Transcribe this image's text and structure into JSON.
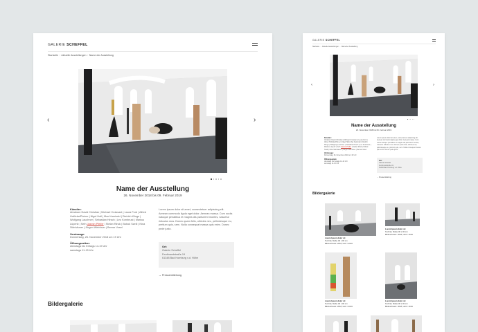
{
  "brand": {
    "name_light": "GALERIE ",
    "name_bold": "SCHEFFEL"
  },
  "breadcrumb": [
    "Startseite",
    "Aktuelle Ausstellungen",
    "Name der Ausstellung"
  ],
  "breadcrumb_separator": "›",
  "exhibition": {
    "title": "Name der Ausstellung",
    "dates": "26. November 2018 bis 09. Februar 2019",
    "artists_label": "Künstler:",
    "artists_before": "Abraham David Christian | Michael Croissant | Laura Ford | Alfred Hrdlicka/Ploiner | Nigel Hall | Max Kaminski | Dietrich Klinge | Wolfgang Lauchner | Sebastian Hirsch | Leo Kornbrust | Markus Lüpertz | Seth ",
    "artists_link": "Jasmin Pfeifer",
    "artists_after": " | Stefan Rinck | Bobok Szeili | Nina Stiinhäuser | Jürgen Weinbuer | Bernar Vosel",
    "opening_label": "Vernissage:",
    "opening_value": "Donnerstag, 26. November 2018 um 19 Uhr",
    "hours_label": "Öffnungszeiten:",
    "hours_line1": "dienstags bis freitags 14-19 Uhr",
    "hours_line2": "samstags 11-15 Uhr",
    "description": "Lorem ipsum dolor sit amet, consectetuer adipiscing elit. Aenean commodo ligula eget dolor. Aenean massa. Cum sociis natoque penatibus et magnis dis parturient montes, nascetur ridiculus mus. Donec quam felis, ultricies nec, pellentesque eu, pretium quis, sem. Nulla consequat massa quis enim. Donec pede justo."
  },
  "location": {
    "title": "Ort:",
    "line1": "Galerie Scheffel",
    "line2": "Ferdinandstraße 19",
    "line3": "61348 Bad Homburg v.d. Höhe"
  },
  "press_link": "Pressemitteilung",
  "gallery": {
    "heading": "Bildergalerie"
  },
  "captions": {
    "title": "Lorem Ipsum dolor sit",
    "line1": "Technik, Maße 00 x 00 cm",
    "line2": "Bildnachweis: 2018, Holz / 2019"
  },
  "slider": {
    "prev": "‹",
    "next": "›",
    "dot_count": 5,
    "active_dot": 1
  },
  "colors": {
    "background": "#e3e7e8",
    "accent_link": "#d0473d",
    "info_box": "#f0f0f0"
  }
}
